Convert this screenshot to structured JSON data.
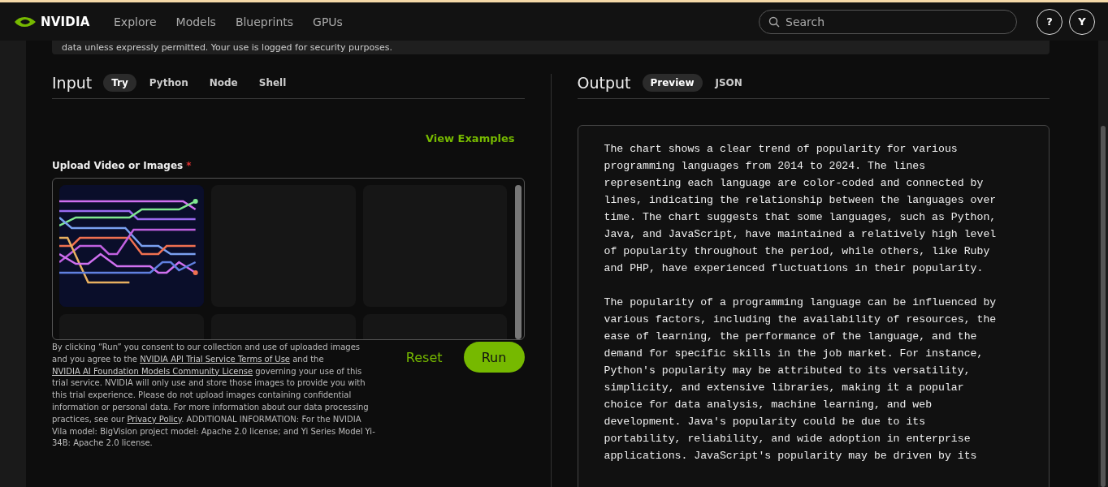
{
  "header": {
    "brand": "NVIDIA",
    "nav": [
      {
        "label": "Explore"
      },
      {
        "label": "Models"
      },
      {
        "label": "Blueprints"
      },
      {
        "label": "GPUs"
      }
    ],
    "search": {
      "placeholder": "Search"
    },
    "help": "?",
    "avatar": "Y"
  },
  "notice": "data unless expressly permitted. Your use is logged for security purposes.",
  "input": {
    "title": "Input",
    "tabs": [
      {
        "label": "Try",
        "selected": true
      },
      {
        "label": "Python",
        "selected": false
      },
      {
        "label": "Node",
        "selected": false
      },
      {
        "label": "Shell",
        "selected": false
      }
    ],
    "view_examples": "View Examples",
    "upload_label": "Upload Video or Images",
    "required_mark": "*",
    "tiles": [
      {
        "kind": "picture"
      },
      {
        "kind": "empty"
      },
      {
        "kind": "empty"
      },
      {
        "kind": "empty"
      },
      {
        "kind": "empty"
      },
      {
        "kind": "empty"
      }
    ],
    "consent": [
      {
        "kind": "text",
        "text": "By clicking “Run” you consent to our collection and use of uploaded images and you agree to the "
      },
      {
        "kind": "link",
        "text": "NVIDIA API Trial Service Terms of Use"
      },
      {
        "kind": "text",
        "text": " and the "
      },
      {
        "kind": "link",
        "text": "NVIDIA AI Foundation Models Community License"
      },
      {
        "kind": "text",
        "text": " governing your use of this trial service. NVIDIA will only use and store those images to provide you with this trial experience. Please do not upload images containing confidential information or personal data. For more information about our data processing practices, see our "
      },
      {
        "kind": "link",
        "text": "Privacy Policy"
      },
      {
        "kind": "text",
        "text": ". ADDITIONAL INFORMATION: For the NVIDIA Vila model: BigVision project model: Apache 2.0 license; and Yi Series Model Yi-34B: Apache 2.0 license."
      }
    ],
    "reset": "Reset",
    "run": "Run"
  },
  "output": {
    "title": "Output",
    "tabs": [
      {
        "label": "Preview",
        "selected": true
      },
      {
        "label": "JSON",
        "selected": false
      }
    ],
    "paragraphs": [
      "The chart shows a clear trend of popularity for various programming languages from 2014 to 2024. The lines representing each language are color-coded and connected by lines, indicating the relationship between the languages over time. The chart suggests that some languages, such as Python, Java, and JavaScript, have maintained a relatively high level of popularity throughout the period, while others, like Ruby and PHP, have experienced fluctuations in their popularity.",
      "The popularity of a programming language can be influenced by various factors, including the availability of resources, the ease of learning, the performance of the language, and the demand for specific skills in the job market. For instance, Python's popularity may be attributed to its versatility, simplicity, and extensive libraries, making it a popular choice for data analysis, machine learning, and web development. Java's popularity could be due to its portability, reliability, and wide adoption in enterprise applications. JavaScript's popularity may be driven by its"
    ]
  }
}
